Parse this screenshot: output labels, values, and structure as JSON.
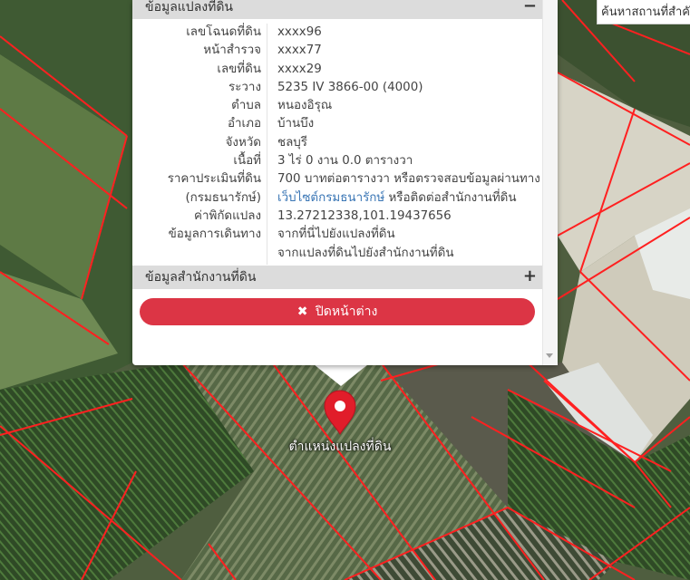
{
  "search": {
    "text": "ค้นหาสถานที่สำคัญ"
  },
  "popup": {
    "section1_title": "ข้อมูลแปลงที่ดิน",
    "section1_toggle": "−",
    "rows": [
      {
        "label": "เลขโฉนดที่ดิน",
        "value": "xxxx96"
      },
      {
        "label": "หน้าสำรวจ",
        "value": "xxxx77"
      },
      {
        "label": "เลขที่ดิน",
        "value": "xxxx29"
      },
      {
        "label": "ระวาง",
        "value": "5235 IV 3866-00 (4000)"
      },
      {
        "label": "ตำบล",
        "value": "หนองอิรุณ"
      },
      {
        "label": "อำเภอ",
        "value": "บ้านบึง"
      },
      {
        "label": "จังหวัด",
        "value": "ชลบุรี"
      },
      {
        "label": "เนื้อที่",
        "value": "3 ไร่ 0 งาน 0.0 ตารางวา"
      },
      {
        "label": "ราคาประเมินที่ดิน",
        "value": "700 บาทต่อตารางวา หรือตรวจสอบข้อมูลผ่านทาง"
      },
      {
        "label": "(กรมธนารักษ์)",
        "value_link": "เว็บไซต์กรมธนารักษ์",
        "value_rest": " หรือติดต่อสำนักงานที่ดิน"
      },
      {
        "label": "ค่าพิกัดแปลง",
        "value_link": "13.27212338,101.19437656"
      },
      {
        "label": "ข้อมูลการเดินทาง",
        "value_link": "จากที่นี่ไปยังแปลงที่ดิน"
      },
      {
        "label": "",
        "value_link": "จากแปลงที่ดินไปยังสำนักงานที่ดิน"
      }
    ],
    "section2_title": "ข้อมูลสำนักงานที่ดิน",
    "section2_toggle": "+",
    "close_label": "ปิดหน้าต่าง",
    "close_icon": "✖"
  },
  "marker": {
    "label": "ตำแหน่งแปลงที่ดิน",
    "color": "#e11d2a"
  },
  "colors": {
    "parcel_line": "#ff2020",
    "accent": "#dc3545",
    "link": "#3a76b5"
  }
}
